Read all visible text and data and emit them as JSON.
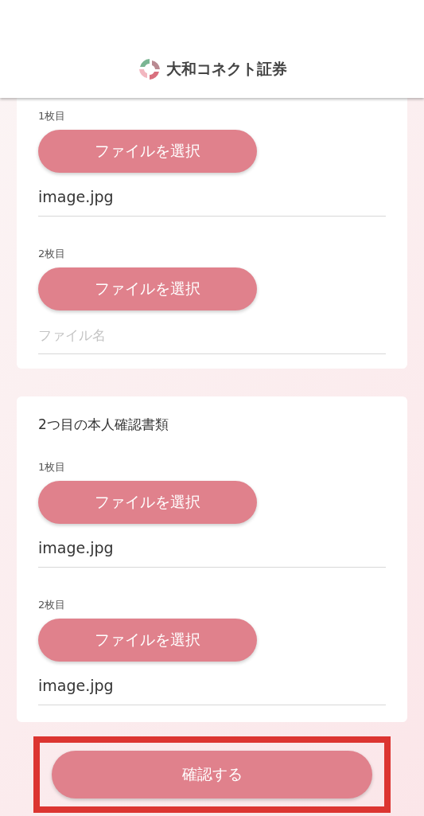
{
  "header": {
    "logo_text": "大和コネクト証券"
  },
  "sections": [
    {
      "files": [
        {
          "label": "1枚目",
          "button": "ファイルを選択",
          "value": "image.jpg"
        },
        {
          "label": "2枚目",
          "button": "ファイルを選択",
          "placeholder": "ファイル名"
        }
      ]
    },
    {
      "title": "2つ目の本人確認書類",
      "files": [
        {
          "label": "1枚目",
          "button": "ファイルを選択",
          "value": "image.jpg"
        },
        {
          "label": "2枚目",
          "button": "ファイルを選択",
          "value": "image.jpg"
        }
      ]
    }
  ],
  "confirm": {
    "label": "確認する",
    "highlighted": true
  }
}
